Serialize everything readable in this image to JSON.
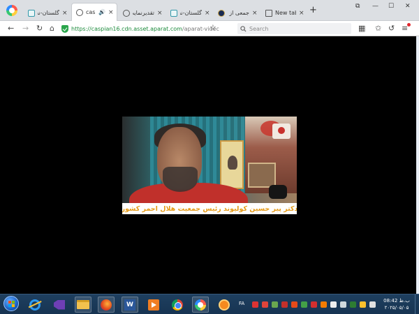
{
  "browser": {
    "tabs": [
      {
        "title": "گلستان-نه",
        "icon": "image-icon",
        "active": false,
        "close": "×"
      },
      {
        "title": "caspian",
        "icon": "globe-icon",
        "active": true,
        "audio": "🔊",
        "close": "×"
      },
      {
        "title": "تقدیرنمایت",
        "icon": "globe-icon",
        "active": false,
        "close": "×"
      },
      {
        "title": "گلستان-نه",
        "icon": "image-icon",
        "active": false,
        "close": "×"
      },
      {
        "title": "جمعی از به",
        "icon": "avatar-icon",
        "active": false,
        "close": "×"
      },
      {
        "title": "New tab",
        "icon": "newtab-icon",
        "active": false,
        "close": "×"
      }
    ],
    "new_tab": "+",
    "window_controls": {
      "restore": "⧉",
      "minimize": "—",
      "maximize": "☐",
      "close": "✕"
    },
    "nav": {
      "back": "←",
      "forward": "→",
      "reload": "↻",
      "home": "⌂"
    },
    "url": {
      "scheme": "https://",
      "host": "caspian16.cdn.asset.aparat.com",
      "path": "/aparat-videc"
    },
    "bookmark_star": "☆",
    "search": {
      "icon": "search-icon",
      "placeholder": "Search"
    },
    "toolbar": {
      "apps": "▦",
      "favorites": "✩",
      "history": "↺",
      "menu": "≡"
    }
  },
  "video": {
    "caption": "دکتر پیر حسین کولیوند رئیس جمعیت هلال احمر کشور"
  },
  "taskbar": {
    "pinned": [
      "ie-icon",
      "visual-studio-icon",
      "folder-icon",
      "firefox-icon",
      "word-icon",
      "media-player-icon",
      "chrome-icon",
      "browser-360-icon",
      "app-icon"
    ],
    "word_label": "W",
    "language": "FA",
    "clock": {
      "time": "08:42 ب.ظ",
      "date": "۲۰۲۵/۰۵/۰۵"
    }
  }
}
